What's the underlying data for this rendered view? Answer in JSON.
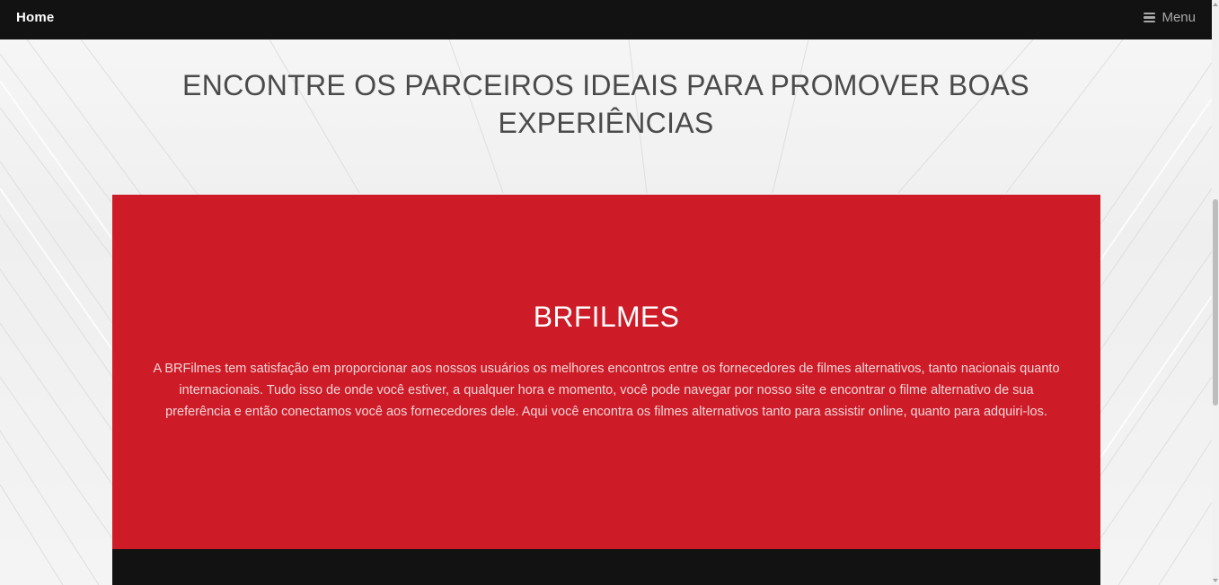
{
  "nav": {
    "brand": "Home",
    "menu_label": "Menu",
    "menu_icon": "hamburger-icon"
  },
  "hero": {
    "headline": "ENCONTRE OS PARCEIROS IDEAIS PARA PROMOVER BOAS EXPERIÊNCIAS"
  },
  "about": {
    "title": "BRFILMES",
    "body": "A BRFilmes tem satisfação em proporcionar aos nossos usuários os melhores encontros entre os fornecedores de filmes alternativos, tanto nacionais quanto internacionais. Tudo isso de onde você estiver, a qualquer hora e momento, você pode navegar por nosso site e encontrar o filme alternativo de sua preferência e então conectamos você aos fornecedores dele. Aqui você encontra os filmes alternativos tanto para assistir online, quanto para adquiri-los."
  },
  "colors": {
    "navbar": "#121212",
    "panel": "#cd1b27",
    "headline_text": "#4a4a4a"
  }
}
